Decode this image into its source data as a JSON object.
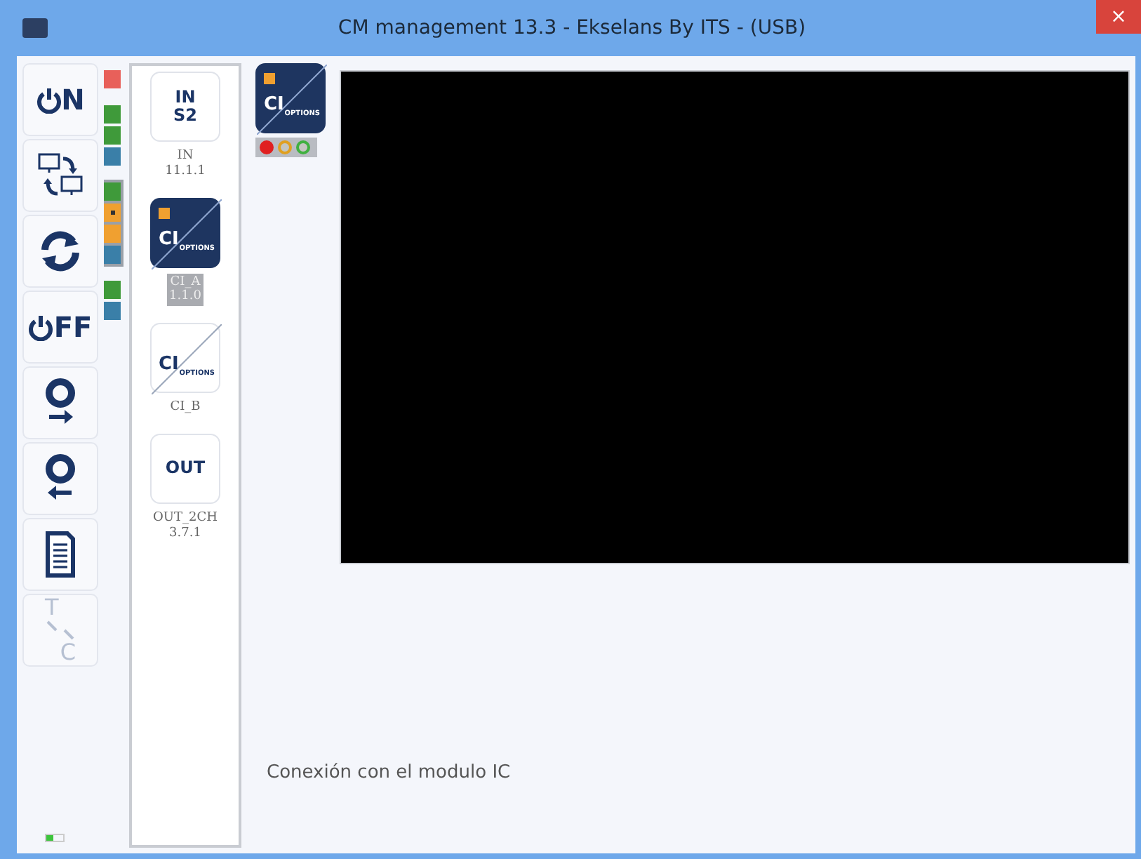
{
  "window": {
    "title": "CM management 13.3 - Ekselans By ITS - (USB)",
    "close": "×"
  },
  "toolbar": [
    {
      "kind": "on",
      "label": "N",
      "disabled": false
    },
    {
      "kind": "swap"
    },
    {
      "kind": "refresh"
    },
    {
      "kind": "off",
      "label": "FF",
      "disabled": false
    },
    {
      "kind": "disk-out"
    },
    {
      "kind": "disk-in"
    },
    {
      "kind": "document"
    },
    {
      "kind": "tc",
      "label_top": "T",
      "label_bottom": "C",
      "disabled": true
    }
  ],
  "indicator_groups": [
    {
      "selected": false,
      "items": [
        {
          "color": "#e8605a"
        }
      ]
    },
    {
      "selected": false,
      "items": [
        {
          "color": "#3f9a3a"
        },
        {
          "color": "#3f9a3a"
        },
        {
          "color": "#3a7fa8"
        }
      ]
    },
    {
      "selected": true,
      "items": [
        {
          "color": "#3f9a3a"
        },
        {
          "color": "#f0a030",
          "marked": true
        },
        {
          "color": "#f0a030"
        },
        {
          "color": "#3a7fa8"
        }
      ]
    },
    {
      "selected": false,
      "items": [
        {
          "color": "#3f9a3a"
        },
        {
          "color": "#3a7fa8"
        }
      ]
    }
  ],
  "modules": [
    {
      "kind": "text",
      "tile_lines": [
        "IN",
        "S2"
      ],
      "caption": [
        "IN",
        "11.1.1"
      ],
      "selected": false
    },
    {
      "kind": "ci",
      "tile_main": "CI",
      "tile_sub": "OPTIONS",
      "caption": [
        "CI_A",
        "1.1.0"
      ],
      "selected": true
    },
    {
      "kind": "ci",
      "tile_main": "CI",
      "tile_sub": "OPTIONS",
      "caption": [
        "CI_B"
      ],
      "selected": false
    },
    {
      "kind": "text",
      "tile_lines": [
        "OUT"
      ],
      "caption": [
        "OUT_2CH",
        "3.7.1"
      ],
      "selected": false
    }
  ],
  "detail": {
    "tile_main": "CI",
    "tile_sub": "OPTIONS",
    "leds": [
      {
        "color": "#e02020",
        "on": true
      },
      {
        "color": "#e0a020",
        "on": false
      },
      {
        "color": "#40b040",
        "on": false
      }
    ],
    "status": "Conexión con el modulo IC"
  },
  "battery": {
    "level": 0.4
  }
}
